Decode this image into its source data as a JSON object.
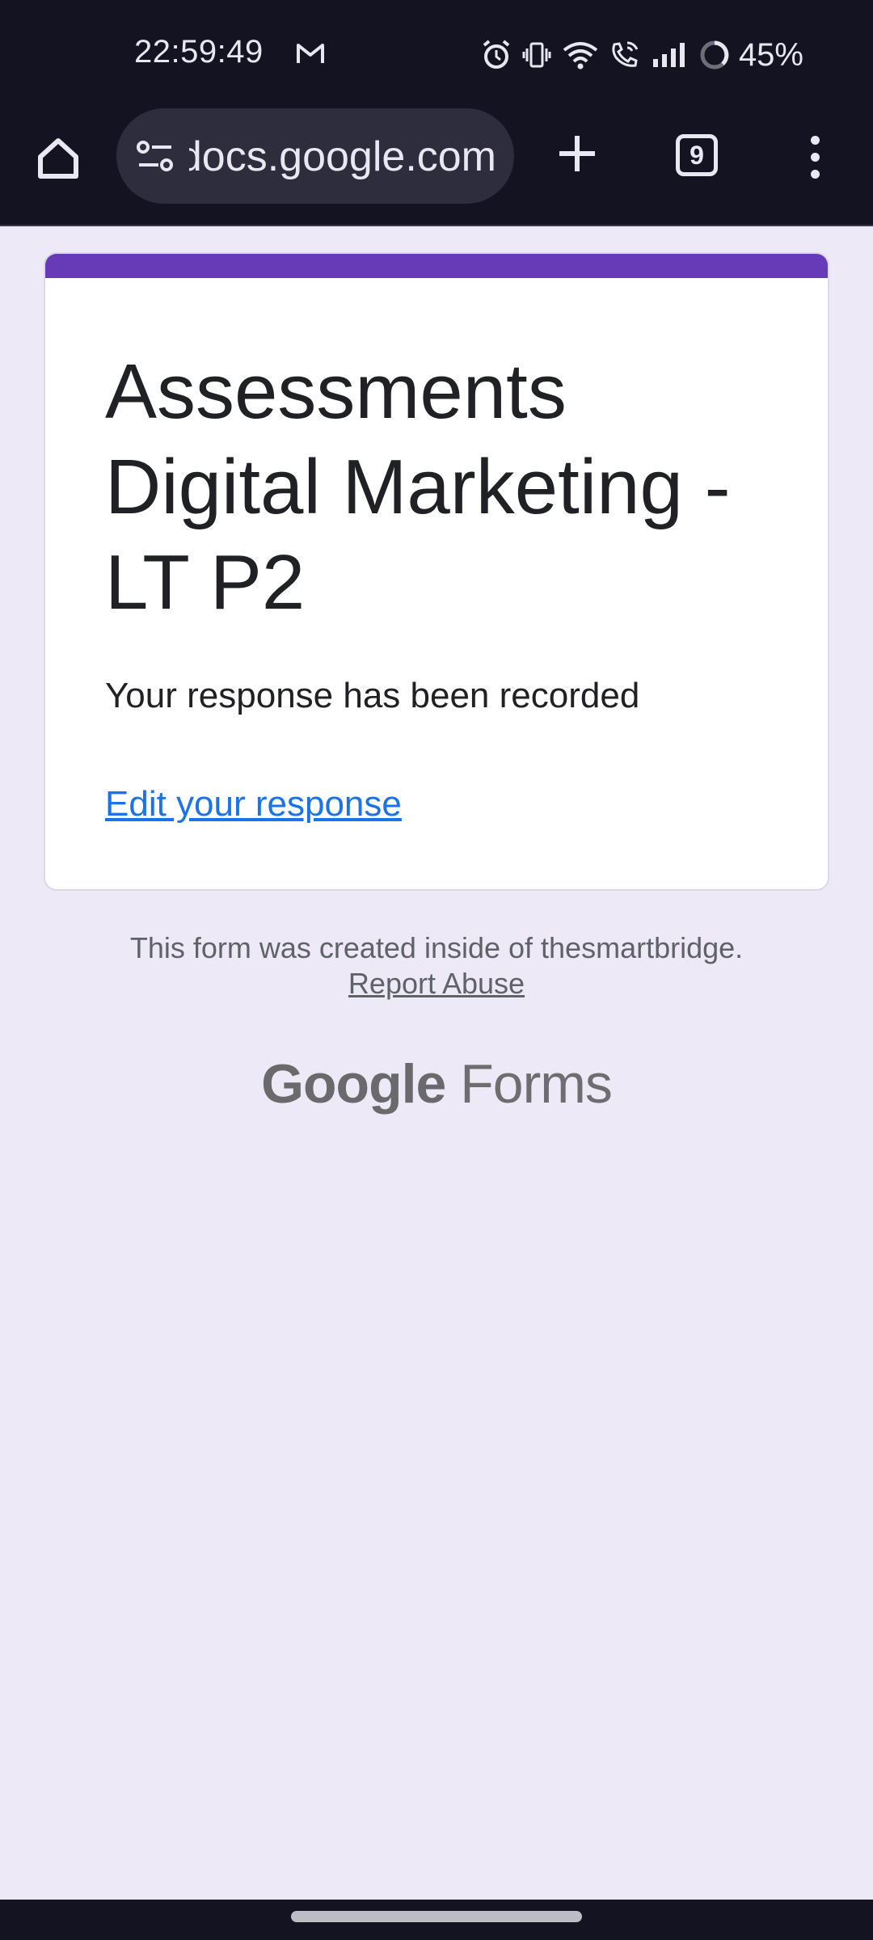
{
  "status_bar": {
    "time": "22:59:49",
    "battery": "45%",
    "icons": [
      "gmail-icon",
      "alarm-icon",
      "vibrate-icon",
      "wifi-icon",
      "wifi-calling-icon",
      "signal-icon",
      "battery-icon"
    ]
  },
  "browser": {
    "url": "docs.google.com",
    "tab_count": "9",
    "icons": [
      "home-icon",
      "site-settings-icon",
      "plus-icon",
      "tabs-icon",
      "more-vert-icon"
    ]
  },
  "form": {
    "accent_color": "#673ab7",
    "title": "Assessments Digital Marketing - LT P2",
    "confirmation": "Your response has been recorded",
    "edit_link": "Edit your response"
  },
  "footer": {
    "created_text": "This form was created inside of thesmartbridge.",
    "report_abuse": "Report Abuse",
    "logo_google": "Google",
    "logo_forms": "Forms"
  }
}
